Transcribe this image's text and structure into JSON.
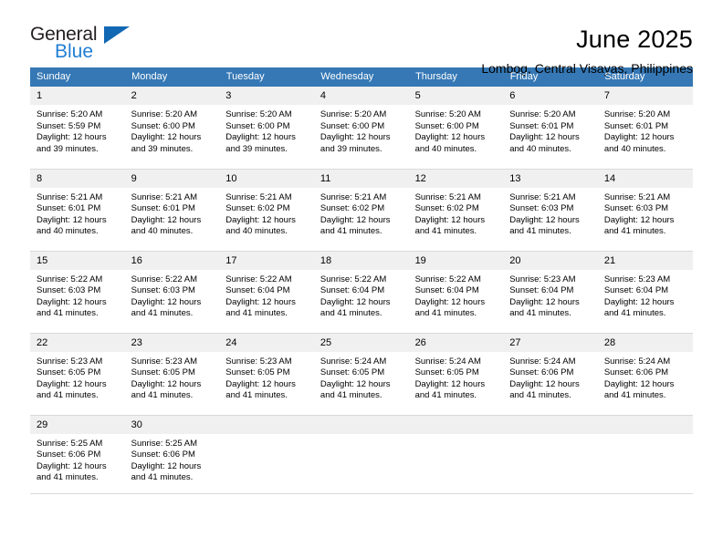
{
  "brand": {
    "name_top": "General",
    "name_bottom": "Blue",
    "triangle_color": "#1268b3",
    "blue_color": "#1f7fd4"
  },
  "header": {
    "title": "June 2025",
    "subtitle": "Lombog, Central Visayas, Philippines"
  },
  "theme": {
    "header_bar": "#3578b5",
    "daynum_band": "#f0f0f0",
    "cell_border": "#d9d9d9",
    "text": "#000000"
  },
  "weekday_headers": [
    "Sunday",
    "Monday",
    "Tuesday",
    "Wednesday",
    "Thursday",
    "Friday",
    "Saturday"
  ],
  "weeks": [
    [
      {
        "day": "1",
        "sunrise": "Sunrise: 5:20 AM",
        "sunset": "Sunset: 5:59 PM",
        "daylight1": "Daylight: 12 hours",
        "daylight2": "and 39 minutes."
      },
      {
        "day": "2",
        "sunrise": "Sunrise: 5:20 AM",
        "sunset": "Sunset: 6:00 PM",
        "daylight1": "Daylight: 12 hours",
        "daylight2": "and 39 minutes."
      },
      {
        "day": "3",
        "sunrise": "Sunrise: 5:20 AM",
        "sunset": "Sunset: 6:00 PM",
        "daylight1": "Daylight: 12 hours",
        "daylight2": "and 39 minutes."
      },
      {
        "day": "4",
        "sunrise": "Sunrise: 5:20 AM",
        "sunset": "Sunset: 6:00 PM",
        "daylight1": "Daylight: 12 hours",
        "daylight2": "and 39 minutes."
      },
      {
        "day": "5",
        "sunrise": "Sunrise: 5:20 AM",
        "sunset": "Sunset: 6:00 PM",
        "daylight1": "Daylight: 12 hours",
        "daylight2": "and 40 minutes."
      },
      {
        "day": "6",
        "sunrise": "Sunrise: 5:20 AM",
        "sunset": "Sunset: 6:01 PM",
        "daylight1": "Daylight: 12 hours",
        "daylight2": "and 40 minutes."
      },
      {
        "day": "7",
        "sunrise": "Sunrise: 5:20 AM",
        "sunset": "Sunset: 6:01 PM",
        "daylight1": "Daylight: 12 hours",
        "daylight2": "and 40 minutes."
      }
    ],
    [
      {
        "day": "8",
        "sunrise": "Sunrise: 5:21 AM",
        "sunset": "Sunset: 6:01 PM",
        "daylight1": "Daylight: 12 hours",
        "daylight2": "and 40 minutes."
      },
      {
        "day": "9",
        "sunrise": "Sunrise: 5:21 AM",
        "sunset": "Sunset: 6:01 PM",
        "daylight1": "Daylight: 12 hours",
        "daylight2": "and 40 minutes."
      },
      {
        "day": "10",
        "sunrise": "Sunrise: 5:21 AM",
        "sunset": "Sunset: 6:02 PM",
        "daylight1": "Daylight: 12 hours",
        "daylight2": "and 40 minutes."
      },
      {
        "day": "11",
        "sunrise": "Sunrise: 5:21 AM",
        "sunset": "Sunset: 6:02 PM",
        "daylight1": "Daylight: 12 hours",
        "daylight2": "and 41 minutes."
      },
      {
        "day": "12",
        "sunrise": "Sunrise: 5:21 AM",
        "sunset": "Sunset: 6:02 PM",
        "daylight1": "Daylight: 12 hours",
        "daylight2": "and 41 minutes."
      },
      {
        "day": "13",
        "sunrise": "Sunrise: 5:21 AM",
        "sunset": "Sunset: 6:03 PM",
        "daylight1": "Daylight: 12 hours",
        "daylight2": "and 41 minutes."
      },
      {
        "day": "14",
        "sunrise": "Sunrise: 5:21 AM",
        "sunset": "Sunset: 6:03 PM",
        "daylight1": "Daylight: 12 hours",
        "daylight2": "and 41 minutes."
      }
    ],
    [
      {
        "day": "15",
        "sunrise": "Sunrise: 5:22 AM",
        "sunset": "Sunset: 6:03 PM",
        "daylight1": "Daylight: 12 hours",
        "daylight2": "and 41 minutes."
      },
      {
        "day": "16",
        "sunrise": "Sunrise: 5:22 AM",
        "sunset": "Sunset: 6:03 PM",
        "daylight1": "Daylight: 12 hours",
        "daylight2": "and 41 minutes."
      },
      {
        "day": "17",
        "sunrise": "Sunrise: 5:22 AM",
        "sunset": "Sunset: 6:04 PM",
        "daylight1": "Daylight: 12 hours",
        "daylight2": "and 41 minutes."
      },
      {
        "day": "18",
        "sunrise": "Sunrise: 5:22 AM",
        "sunset": "Sunset: 6:04 PM",
        "daylight1": "Daylight: 12 hours",
        "daylight2": "and 41 minutes."
      },
      {
        "day": "19",
        "sunrise": "Sunrise: 5:22 AM",
        "sunset": "Sunset: 6:04 PM",
        "daylight1": "Daylight: 12 hours",
        "daylight2": "and 41 minutes."
      },
      {
        "day": "20",
        "sunrise": "Sunrise: 5:23 AM",
        "sunset": "Sunset: 6:04 PM",
        "daylight1": "Daylight: 12 hours",
        "daylight2": "and 41 minutes."
      },
      {
        "day": "21",
        "sunrise": "Sunrise: 5:23 AM",
        "sunset": "Sunset: 6:04 PM",
        "daylight1": "Daylight: 12 hours",
        "daylight2": "and 41 minutes."
      }
    ],
    [
      {
        "day": "22",
        "sunrise": "Sunrise: 5:23 AM",
        "sunset": "Sunset: 6:05 PM",
        "daylight1": "Daylight: 12 hours",
        "daylight2": "and 41 minutes."
      },
      {
        "day": "23",
        "sunrise": "Sunrise: 5:23 AM",
        "sunset": "Sunset: 6:05 PM",
        "daylight1": "Daylight: 12 hours",
        "daylight2": "and 41 minutes."
      },
      {
        "day": "24",
        "sunrise": "Sunrise: 5:23 AM",
        "sunset": "Sunset: 6:05 PM",
        "daylight1": "Daylight: 12 hours",
        "daylight2": "and 41 minutes."
      },
      {
        "day": "25",
        "sunrise": "Sunrise: 5:24 AM",
        "sunset": "Sunset: 6:05 PM",
        "daylight1": "Daylight: 12 hours",
        "daylight2": "and 41 minutes."
      },
      {
        "day": "26",
        "sunrise": "Sunrise: 5:24 AM",
        "sunset": "Sunset: 6:05 PM",
        "daylight1": "Daylight: 12 hours",
        "daylight2": "and 41 minutes."
      },
      {
        "day": "27",
        "sunrise": "Sunrise: 5:24 AM",
        "sunset": "Sunset: 6:06 PM",
        "daylight1": "Daylight: 12 hours",
        "daylight2": "and 41 minutes."
      },
      {
        "day": "28",
        "sunrise": "Sunrise: 5:24 AM",
        "sunset": "Sunset: 6:06 PM",
        "daylight1": "Daylight: 12 hours",
        "daylight2": "and 41 minutes."
      }
    ],
    [
      {
        "day": "29",
        "sunrise": "Sunrise: 5:25 AM",
        "sunset": "Sunset: 6:06 PM",
        "daylight1": "Daylight: 12 hours",
        "daylight2": "and 41 minutes."
      },
      {
        "day": "30",
        "sunrise": "Sunrise: 5:25 AM",
        "sunset": "Sunset: 6:06 PM",
        "daylight1": "Daylight: 12 hours",
        "daylight2": "and 41 minutes."
      },
      {
        "day": "",
        "sunrise": "",
        "sunset": "",
        "daylight1": "",
        "daylight2": ""
      },
      {
        "day": "",
        "sunrise": "",
        "sunset": "",
        "daylight1": "",
        "daylight2": ""
      },
      {
        "day": "",
        "sunrise": "",
        "sunset": "",
        "daylight1": "",
        "daylight2": ""
      },
      {
        "day": "",
        "sunrise": "",
        "sunset": "",
        "daylight1": "",
        "daylight2": ""
      },
      {
        "day": "",
        "sunrise": "",
        "sunset": "",
        "daylight1": "",
        "daylight2": ""
      }
    ]
  ]
}
